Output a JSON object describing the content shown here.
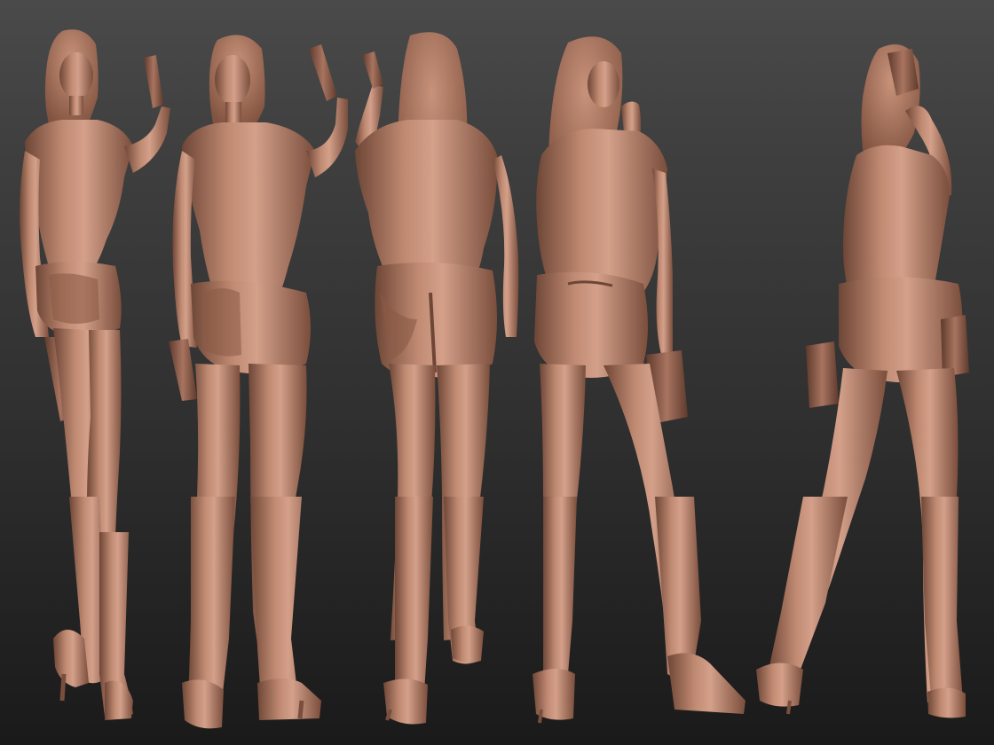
{
  "scene": {
    "background_top": "#4a4a4a",
    "background_bottom": "#1a1a1a",
    "material_color": "#b07a62",
    "material_light": "#d4a08a",
    "material_shadow": "#6e4636",
    "figures": [
      {
        "view": "front-three-quarter"
      },
      {
        "view": "front-turned"
      },
      {
        "view": "back"
      },
      {
        "view": "back-three-quarter"
      },
      {
        "view": "side-profile"
      }
    ]
  }
}
